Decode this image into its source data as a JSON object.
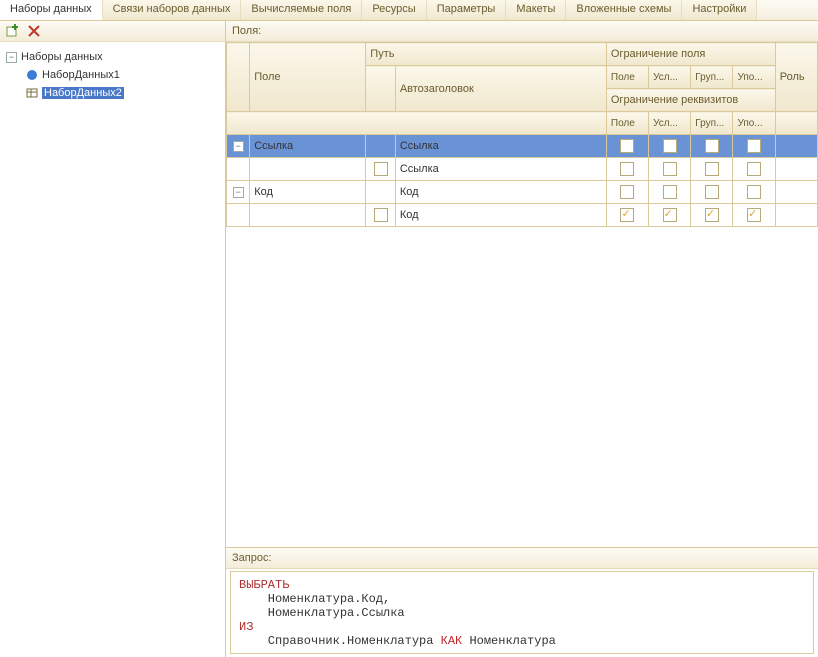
{
  "tabs": [
    "Наборы данных",
    "Связи наборов данных",
    "Вычисляемые поля",
    "Ресурсы",
    "Параметры",
    "Макеты",
    "Вложенные схемы",
    "Настройки"
  ],
  "activeTab": 0,
  "tree": {
    "root": "Наборы данных",
    "items": [
      "НаборДанных1",
      "НаборДанных2"
    ],
    "selected": 1
  },
  "fieldsLabel": "Поля:",
  "headers": {
    "field": "Поле",
    "path": "Путь",
    "auto": "Автозаголовок",
    "limField": "Ограничение поля",
    "limReq": "Ограничение реквизитов",
    "role": "Роль",
    "c1": "Поле",
    "c2": "Усл...",
    "c3": "Груп...",
    "c4": "Упо..."
  },
  "rows": [
    {
      "exp": true,
      "field": "Ссылка",
      "path": "Ссылка",
      "cb": false,
      "checks": [
        false,
        false,
        false,
        false
      ],
      "sel": true
    },
    {
      "exp": false,
      "field": "",
      "path": "Ссылка",
      "cb": true,
      "cbv": false,
      "checks": [
        false,
        false,
        false,
        false
      ]
    },
    {
      "exp": true,
      "field": "Код",
      "path": "Код",
      "cb": false,
      "checks": [
        false,
        false,
        false,
        false
      ]
    },
    {
      "exp": false,
      "field": "",
      "path": "Код",
      "cb": true,
      "cbv": false,
      "checks": [
        true,
        true,
        true,
        true
      ]
    }
  ],
  "queryLabel": "Запрос:",
  "query": {
    "kw_select": "ВЫБРАТЬ",
    "l1": "    Номенклатура.Код,",
    "l2": "    Номенклатура.Ссылка",
    "kw_from": "ИЗ",
    "l3a": "    Справочник.Номенклатура ",
    "kw_as": "КАК",
    "l3b": " Номенклатура"
  }
}
